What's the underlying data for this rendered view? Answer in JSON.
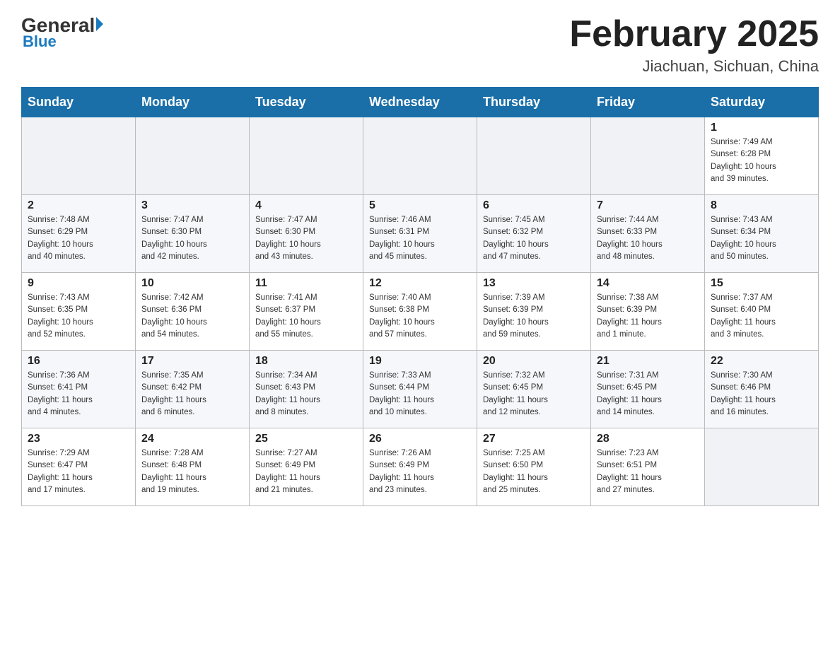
{
  "header": {
    "logo": {
      "general": "General",
      "triangle": "",
      "blue": "Blue"
    },
    "title": "February 2025",
    "location": "Jiachuan, Sichuan, China"
  },
  "weekdays": [
    "Sunday",
    "Monday",
    "Tuesday",
    "Wednesday",
    "Thursday",
    "Friday",
    "Saturday"
  ],
  "weeks": [
    {
      "days": [
        {
          "num": "",
          "info": ""
        },
        {
          "num": "",
          "info": ""
        },
        {
          "num": "",
          "info": ""
        },
        {
          "num": "",
          "info": ""
        },
        {
          "num": "",
          "info": ""
        },
        {
          "num": "",
          "info": ""
        },
        {
          "num": "1",
          "info": "Sunrise: 7:49 AM\nSunset: 6:28 PM\nDaylight: 10 hours\nand 39 minutes."
        }
      ]
    },
    {
      "days": [
        {
          "num": "2",
          "info": "Sunrise: 7:48 AM\nSunset: 6:29 PM\nDaylight: 10 hours\nand 40 minutes."
        },
        {
          "num": "3",
          "info": "Sunrise: 7:47 AM\nSunset: 6:30 PM\nDaylight: 10 hours\nand 42 minutes."
        },
        {
          "num": "4",
          "info": "Sunrise: 7:47 AM\nSunset: 6:30 PM\nDaylight: 10 hours\nand 43 minutes."
        },
        {
          "num": "5",
          "info": "Sunrise: 7:46 AM\nSunset: 6:31 PM\nDaylight: 10 hours\nand 45 minutes."
        },
        {
          "num": "6",
          "info": "Sunrise: 7:45 AM\nSunset: 6:32 PM\nDaylight: 10 hours\nand 47 minutes."
        },
        {
          "num": "7",
          "info": "Sunrise: 7:44 AM\nSunset: 6:33 PM\nDaylight: 10 hours\nand 48 minutes."
        },
        {
          "num": "8",
          "info": "Sunrise: 7:43 AM\nSunset: 6:34 PM\nDaylight: 10 hours\nand 50 minutes."
        }
      ]
    },
    {
      "days": [
        {
          "num": "9",
          "info": "Sunrise: 7:43 AM\nSunset: 6:35 PM\nDaylight: 10 hours\nand 52 minutes."
        },
        {
          "num": "10",
          "info": "Sunrise: 7:42 AM\nSunset: 6:36 PM\nDaylight: 10 hours\nand 54 minutes."
        },
        {
          "num": "11",
          "info": "Sunrise: 7:41 AM\nSunset: 6:37 PM\nDaylight: 10 hours\nand 55 minutes."
        },
        {
          "num": "12",
          "info": "Sunrise: 7:40 AM\nSunset: 6:38 PM\nDaylight: 10 hours\nand 57 minutes."
        },
        {
          "num": "13",
          "info": "Sunrise: 7:39 AM\nSunset: 6:39 PM\nDaylight: 10 hours\nand 59 minutes."
        },
        {
          "num": "14",
          "info": "Sunrise: 7:38 AM\nSunset: 6:39 PM\nDaylight: 11 hours\nand 1 minute."
        },
        {
          "num": "15",
          "info": "Sunrise: 7:37 AM\nSunset: 6:40 PM\nDaylight: 11 hours\nand 3 minutes."
        }
      ]
    },
    {
      "days": [
        {
          "num": "16",
          "info": "Sunrise: 7:36 AM\nSunset: 6:41 PM\nDaylight: 11 hours\nand 4 minutes."
        },
        {
          "num": "17",
          "info": "Sunrise: 7:35 AM\nSunset: 6:42 PM\nDaylight: 11 hours\nand 6 minutes."
        },
        {
          "num": "18",
          "info": "Sunrise: 7:34 AM\nSunset: 6:43 PM\nDaylight: 11 hours\nand 8 minutes."
        },
        {
          "num": "19",
          "info": "Sunrise: 7:33 AM\nSunset: 6:44 PM\nDaylight: 11 hours\nand 10 minutes."
        },
        {
          "num": "20",
          "info": "Sunrise: 7:32 AM\nSunset: 6:45 PM\nDaylight: 11 hours\nand 12 minutes."
        },
        {
          "num": "21",
          "info": "Sunrise: 7:31 AM\nSunset: 6:45 PM\nDaylight: 11 hours\nand 14 minutes."
        },
        {
          "num": "22",
          "info": "Sunrise: 7:30 AM\nSunset: 6:46 PM\nDaylight: 11 hours\nand 16 minutes."
        }
      ]
    },
    {
      "days": [
        {
          "num": "23",
          "info": "Sunrise: 7:29 AM\nSunset: 6:47 PM\nDaylight: 11 hours\nand 17 minutes."
        },
        {
          "num": "24",
          "info": "Sunrise: 7:28 AM\nSunset: 6:48 PM\nDaylight: 11 hours\nand 19 minutes."
        },
        {
          "num": "25",
          "info": "Sunrise: 7:27 AM\nSunset: 6:49 PM\nDaylight: 11 hours\nand 21 minutes."
        },
        {
          "num": "26",
          "info": "Sunrise: 7:26 AM\nSunset: 6:49 PM\nDaylight: 11 hours\nand 23 minutes."
        },
        {
          "num": "27",
          "info": "Sunrise: 7:25 AM\nSunset: 6:50 PM\nDaylight: 11 hours\nand 25 minutes."
        },
        {
          "num": "28",
          "info": "Sunrise: 7:23 AM\nSunset: 6:51 PM\nDaylight: 11 hours\nand 27 minutes."
        },
        {
          "num": "",
          "info": ""
        }
      ]
    }
  ]
}
